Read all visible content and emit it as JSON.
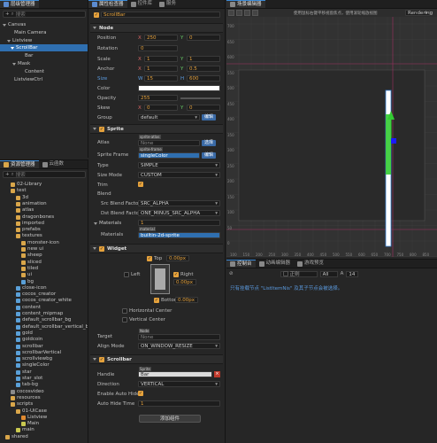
{
  "hierarchy": {
    "tab": "层级管理器",
    "search_placeholder": "搜索",
    "nodes": [
      "Canvas",
      "Main Camera",
      "Listview",
      "ScrollBar",
      "Bar",
      "Mask",
      "Content",
      "ListviewCtrl"
    ]
  },
  "assets": {
    "tabs": [
      "资源管理器",
      "云函数"
    ],
    "search_placeholder": "搜索",
    "items": [
      "02-Library",
      "test",
      "3d",
      "animation",
      "atlas",
      "dragonbones",
      "imported",
      "prefabs",
      "textures",
      "monster-icon",
      "new ui",
      "sheep",
      "sliced",
      "tiled",
      "ui",
      "bg",
      "close-icon",
      "cocos_creator",
      "cocos_creator_white",
      "content",
      "content_mipmap",
      "default_scrollbar_bg",
      "default_scrollbar_vertical_bg",
      "gold",
      "goldcoin",
      "scrollbar",
      "scrollbarVertical",
      "scrollviewbg",
      "singleColor",
      "star",
      "star_slot",
      "tab-bg",
      "cocosvideo",
      "resources",
      "scripts",
      "01-UiCase",
      "Listview",
      "Main",
      "main",
      "shared"
    ]
  },
  "inspector": {
    "tabs": [
      "属性检查器",
      "控件库",
      "服务"
    ],
    "node_name": "ScrollBar",
    "node_section": "Node",
    "props": {
      "position_label": "Position",
      "pos_x": "250",
      "pos_y": "0",
      "rotation_label": "Rotation",
      "rotation": "0",
      "scale_label": "Scale",
      "scale_x": "1",
      "scale_y": "1",
      "anchor_label": "Anchor",
      "anchor_x": "1",
      "anchor_y": "0.5",
      "size_label": "Size",
      "size_w": "15",
      "size_h": "600",
      "color_label": "Color",
      "opacity_label": "Opacity",
      "opacity": "255",
      "skew_label": "Skew",
      "skew_x": "0",
      "skew_y": "0",
      "group_label": "Group",
      "group": "default",
      "edit": "编辑"
    },
    "sprite": {
      "title": "Sprite",
      "atlas_label": "Atlas",
      "atlas_tag": "sprite-atlas",
      "atlas_value": "None",
      "choose": "选择",
      "frame_label": "Sprite Frame",
      "frame_tag": "sprite-frame",
      "frame_value": "singleColor",
      "edit": "编辑",
      "type_label": "Type",
      "type": "SIMPLE",
      "size_mode_label": "Size Mode",
      "size_mode": "CUSTOM",
      "trim_label": "Trim",
      "blend_label": "Blend",
      "src_label": "Src Blend Factor",
      "src": "SRC_ALPHA",
      "dst_label": "Dst Blend Factor",
      "dst": "ONE_MINUS_SRC_ALPHA",
      "materials_label": "Materials",
      "materials_count": "1",
      "mat_label": "Materials",
      "mat_tag": "material",
      "mat_value": "builtin-2d-sprite"
    },
    "widget": {
      "title": "Widget",
      "top": "Top",
      "top_val": "0.00px",
      "left": "Left",
      "right": "Right",
      "right_val": "0.00px",
      "bottom": "Bottom",
      "bottom_val": "0.00px",
      "hcenter": "Horizontal Center",
      "vcenter": "Vertical Center",
      "target_label": "Target",
      "target_tag": "Node",
      "target_value": "None",
      "align_label": "Align Mode",
      "align_value": "ON_WINDOW_RESIZE"
    },
    "scrollbar": {
      "title": "Scrollbar",
      "handle_label": "Handle",
      "handle_tag": "Sprite",
      "handle_value": "Bar",
      "direction_label": "Direction",
      "direction": "VERTICAL",
      "autohide_label": "Enable Auto Hide",
      "autohide_time_label": "Auto Hide Time",
      "autohide_time": "1"
    },
    "add_component": "添加组件"
  },
  "scene": {
    "tab": "场景编辑器",
    "hint": "使用鼠标右键平移视窗焦点，使用滚轮缩放视图",
    "render_mode": "Rendering",
    "y_ticks": [
      "700",
      "650",
      "600",
      "550",
      "500",
      "450",
      "400",
      "350",
      "300",
      "250",
      "200",
      "150",
      "100",
      "50",
      "0"
    ],
    "x_ticks": [
      "100",
      "150",
      "200",
      "250",
      "300",
      "350",
      "400",
      "450",
      "500",
      "550",
      "600",
      "650",
      "700",
      "750",
      "800",
      "850"
    ]
  },
  "console": {
    "tabs": [
      "控制台",
      "动画编辑器",
      "游戏预览"
    ],
    "filter_placeholder": "正则",
    "level": "All",
    "font_size": "14",
    "message": "只有挂载节点 \"ListItemNis\" 及其子节点会被选择。"
  },
  "colors": {
    "accent": "#2f6fb0",
    "orange": "#e6a23c",
    "selection": "#3a6aa6",
    "handle_green": "#33cc33",
    "anchor_blue": "#1a1aff"
  }
}
